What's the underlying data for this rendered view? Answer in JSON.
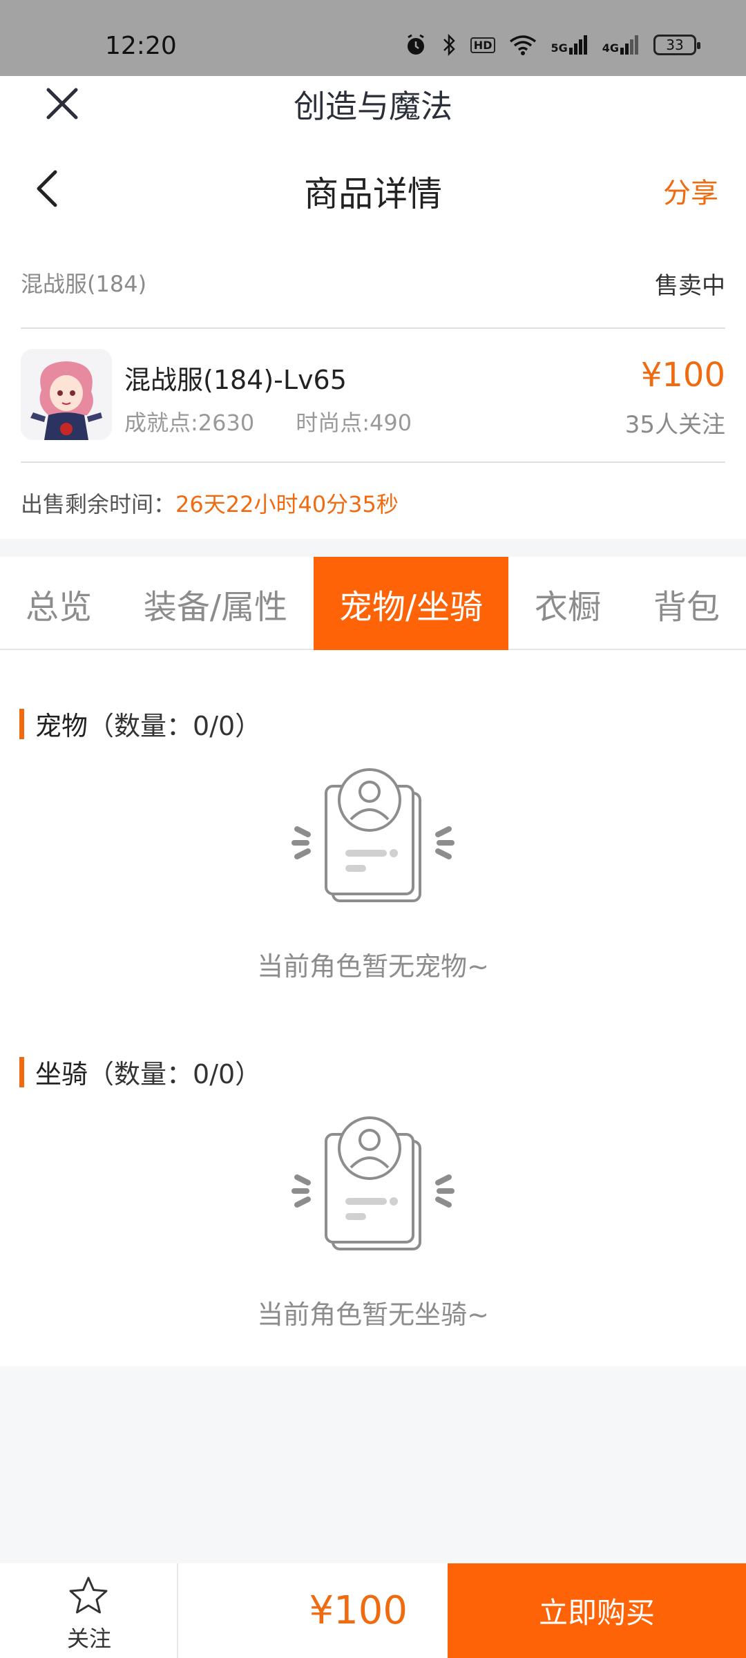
{
  "status_bar": {
    "time": "12:20",
    "hd_label": "HD",
    "net1": "5G",
    "net2": "4G",
    "battery": "33",
    "icons": [
      "alarm-icon",
      "bluetooth-icon",
      "hd-icon",
      "wifi-icon",
      "signal-5g-icon",
      "signal-4g-icon",
      "battery-icon"
    ]
  },
  "mini_header": {
    "title": "创造与魔法"
  },
  "nav": {
    "title": "商品详情",
    "share": "分享"
  },
  "server": {
    "name": "混战服(184)",
    "status": "售卖中"
  },
  "product": {
    "title": "混战服(184)-Lv65",
    "achievement": "成就点:2630",
    "fashion": "时尚点:490",
    "price": "¥100",
    "followers": "35人关注"
  },
  "remaining": {
    "label": "出售剩余时间：",
    "countdown": "26天22小时40分35秒"
  },
  "tabs": [
    {
      "label": "总览",
      "active": false
    },
    {
      "label": "装备/属性",
      "active": false
    },
    {
      "label": "宠物/坐骑",
      "active": true
    },
    {
      "label": "衣橱",
      "active": false
    },
    {
      "label": "背包",
      "active": false
    }
  ],
  "sections": {
    "pets": {
      "title": "宠物",
      "count": "（数量：0/0）",
      "empty": "当前角色暂无宠物~"
    },
    "mounts": {
      "title": "坐骑",
      "count": "（数量：0/0）",
      "empty": "当前角色暂无坐骑~"
    }
  },
  "bottom": {
    "follow": "关注",
    "price": "¥100",
    "buy": "立即购买"
  },
  "colors": {
    "accent": "#ff6308",
    "accent_text": "#f06a10",
    "status_bar": "#a3a3a3"
  }
}
